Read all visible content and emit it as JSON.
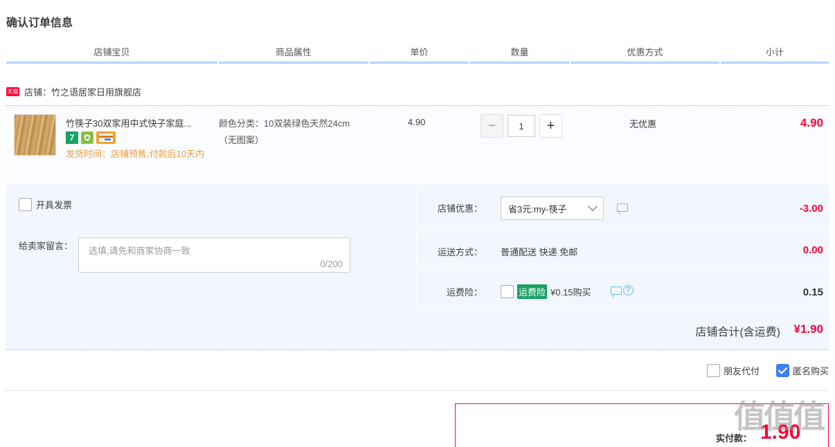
{
  "title": "确认订单信息",
  "table_headers": [
    "店铺宝贝",
    "商品属性",
    "单价",
    "数量",
    "优惠方式",
    "小计"
  ],
  "shop": {
    "badge": "天猫",
    "label": "店铺：竹之语居家日用旗舰店"
  },
  "item": {
    "name": "竹筷子30双家用中式快子家庭...",
    "badges": [
      "7",
      "shield",
      "card"
    ],
    "ship_time": "发货时间：店铺预售,付款后10天内",
    "attr": "颜色分类：10双装绿色天然24cm（无图案）",
    "price": "4.90",
    "qty": "1",
    "promo": "无优惠",
    "subtotal": "4.90"
  },
  "invoice_label": "开具发票",
  "message": {
    "label": "给卖家留言：",
    "placeholder": "选填,请先和商家协商一致",
    "counter": "0/200"
  },
  "shop_discount": {
    "label": "店铺优惠：",
    "selected": "省3元:my-筷子",
    "amount": "-3.00"
  },
  "shipping": {
    "label": "运送方式：",
    "value": "普通配送 快递 免邮",
    "amount": "0.00"
  },
  "insurance": {
    "label": "运费险：",
    "tag": "运费险",
    "text": "¥0.15购买",
    "amount": "0.15"
  },
  "shop_total": {
    "label": "店铺合计(含运费)",
    "amount": "¥1.90"
  },
  "extra_options": {
    "friend_pay": "朋友代付",
    "anonymous": "匿名购买"
  },
  "payment": {
    "label": "实付款：",
    "amount": "1.90"
  },
  "watermark": "值值值",
  "colors": {
    "accent": "#ff0036",
    "header_rule": "#b2d1ff",
    "panel": "#f2f7ff",
    "green": "#1aa064"
  }
}
